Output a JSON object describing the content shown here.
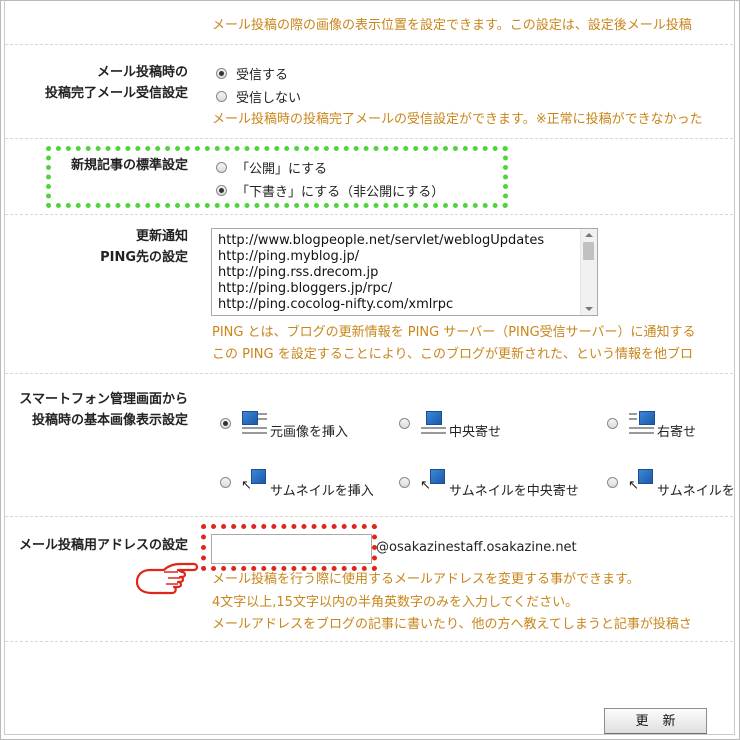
{
  "top_desc": "メール投稿の際の画像の表示位置を設定できます。この設定は、設定後メール投稿",
  "mail_complete": {
    "label_line1": "メール投稿時の",
    "label_line2": "投稿完了メール受信設定",
    "options": [
      "受信する",
      "受信しない"
    ],
    "selected": "受信する",
    "desc": "メール投稿時の投稿完了メールの受信設定ができます。※正常に投稿ができなかった"
  },
  "new_article": {
    "label": "新規記事の標準設定",
    "options": [
      "「公開」にする",
      "「下書き」にする（非公開にする）"
    ],
    "selected": "「下書き」にする（非公開にする）"
  },
  "ping": {
    "label_line1": "更新通知",
    "label_line2": "PING先の設定",
    "urls": [
      "http://www.blogpeople.net/servlet/weblogUpdates",
      "http://ping.myblog.jp/",
      "http://ping.rss.drecom.jp",
      "http://ping.bloggers.jp/rpc/",
      "http://ping.cocolog-nifty.com/xmlrpc"
    ],
    "desc_line1": "PING とは、ブログの更新情報を PING サーバー（PING受信サーバー）に通知する",
    "desc_line2": "この PING を設定することにより、このブログが更新された、という情報を他ブロ"
  },
  "smartphone": {
    "label_line1": "スマートフォン管理画面から",
    "label_line2": "投稿時の基本画像表示設定",
    "row1": [
      "元画像を挿入",
      "中央寄せ",
      "右寄せ"
    ],
    "row2": [
      "サムネイルを挿入",
      "サムネイルを中央寄せ",
      "サムネイルを"
    ],
    "selected": "元画像を挿入"
  },
  "mail_address": {
    "label": "メール投稿用アドレスの設定",
    "value": "",
    "domain": "@osakazinestaff.osakazine.net",
    "desc_line1": "メール投稿を行う際に使用するメールアドレスを変更する事ができます。",
    "desc_line2": "4文字以上,15文字以内の半角英数字のみを入力してください。",
    "desc_line3": "メールアドレスをブログの記事に書いたり、他の方へ教えてしまうと記事が投稿さ"
  },
  "update_button": "更新",
  "colors": {
    "desc_text": "#c8861b",
    "highlight_green": "#4fd53b",
    "highlight_red": "#e0261b"
  }
}
